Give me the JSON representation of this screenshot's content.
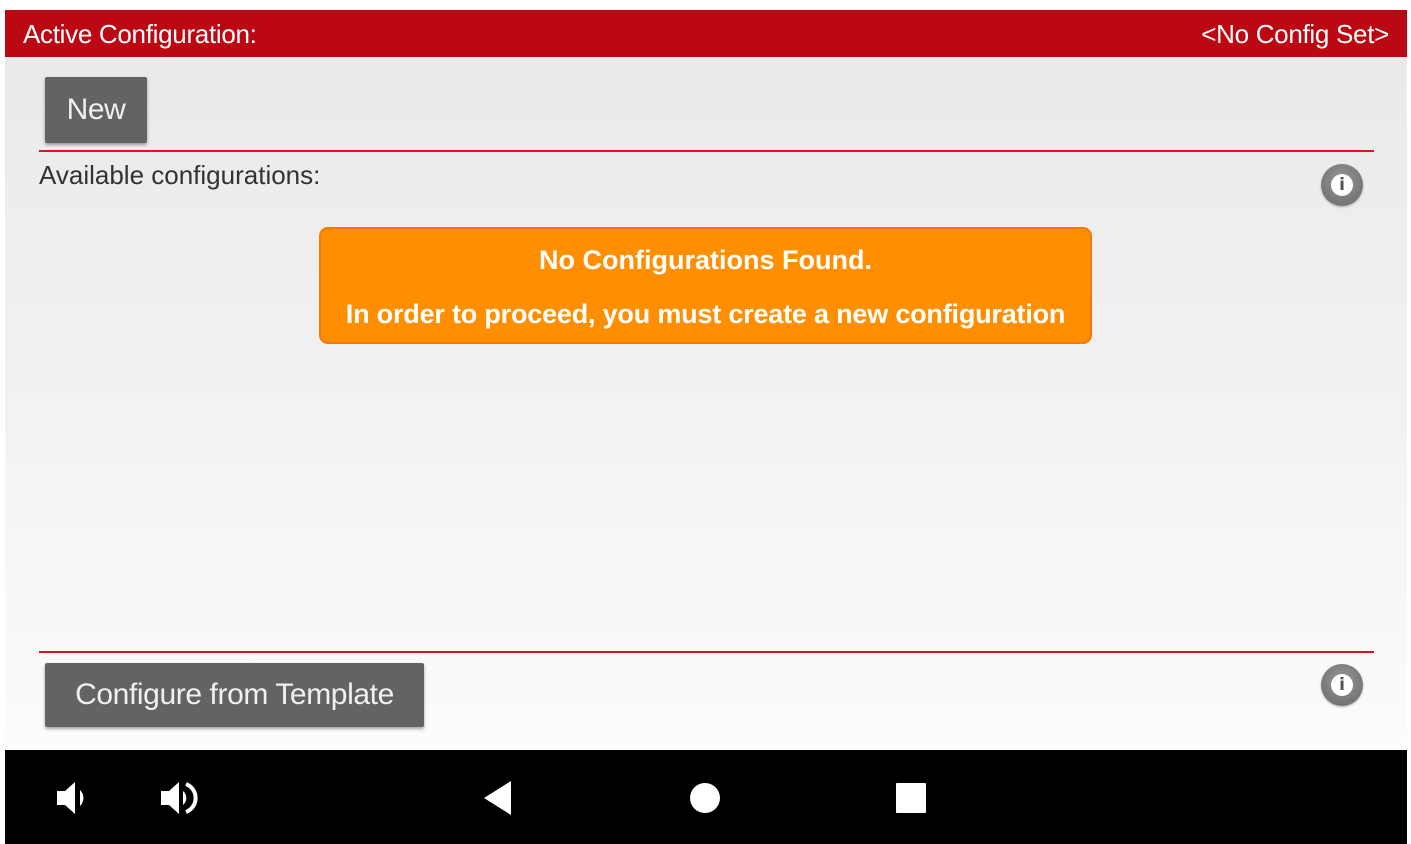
{
  "header": {
    "label": "Active Configuration:",
    "value": "<No Config Set>",
    "background_color": "#bb0812"
  },
  "toolbar": {
    "new_label": "New"
  },
  "configurations": {
    "section_label": "Available configurations:",
    "info_icon": "info-icon",
    "alert": {
      "title": "No Configurations Found.",
      "message": "In order to proceed, you must create a new configuration",
      "background_color": "#ff8f00"
    }
  },
  "footer": {
    "template_label": "Configure from Template",
    "info_icon": "info-icon"
  },
  "navbar": {
    "buttons": [
      "volume-down-icon",
      "volume-up-icon",
      "back-icon",
      "home-icon",
      "recents-icon"
    ]
  },
  "colors": {
    "accent_red": "#e0141e",
    "button_gray": "#616365"
  }
}
